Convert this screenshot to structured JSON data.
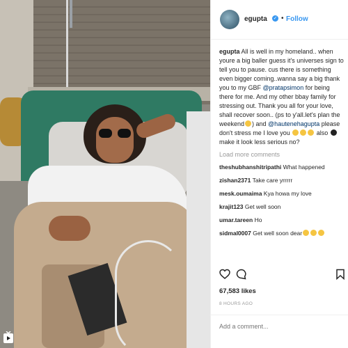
{
  "post": {
    "username": "egupta",
    "follow_label": "Follow",
    "separator": "•"
  },
  "caption": {
    "author": "egupta",
    "text_1": "All is well in my homeland.. when youre a big baller guess it's universes sign to tell you to pause. cus there is something even bigger coming..wanna say a big thank you to my GBF ",
    "mention_1": "@pratapsimon",
    "text_2": " for being there for me. And my other bbay family for stressing out. Thank you all for your love, shall recover soon.. (ps to y'all.let's plan the weekend",
    "text_3": ") and ",
    "mention_2": "@hautenehagupta",
    "text_4": " please don't stress me I love you ",
    "text_5": " also ",
    "text_6": " make it look less serious no?"
  },
  "load_more": "Load more comments",
  "comments": [
    {
      "user": "theshubhanshitripathi",
      "text": "What happened"
    },
    {
      "user": "zishan2371",
      "text": "Take care yrrrrr"
    },
    {
      "user": "mesk.oumaima",
      "text": "Kya howa my love"
    },
    {
      "user": "krajit123",
      "text": "Get well soon"
    },
    {
      "user": "umar.tareen",
      "text": "Ho"
    },
    {
      "user": "sidmal0007",
      "text": "Get well soon dear"
    }
  ],
  "likes": "67,583 likes",
  "time": "8 HOURS AGO",
  "add_comment_placeholder": "Add a comment...",
  "icons": [
    "heart-icon",
    "comment-icon",
    "bookmark-icon",
    "verified-icon",
    "igtv-icon"
  ],
  "colors": {
    "link": "#3897f0",
    "mention": "#003569",
    "muted": "#999999",
    "bed": "#2f7a63"
  }
}
